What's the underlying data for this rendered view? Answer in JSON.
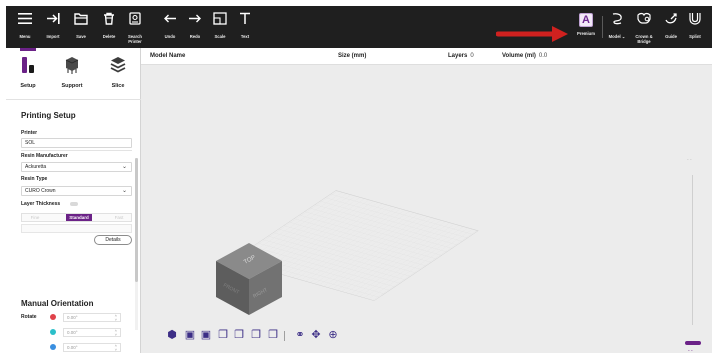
{
  "toolbar": {
    "items": [
      {
        "label": "Menu",
        "icon": "hamburger-icon"
      },
      {
        "label": "Import",
        "icon": "import-icon"
      },
      {
        "label": "Save",
        "icon": "save-icon"
      },
      {
        "label": "Delete",
        "icon": "trash-icon"
      },
      {
        "label": "Search\nPrinter",
        "icon": "search-printer-icon"
      },
      {
        "label": "Undo",
        "icon": "undo-icon"
      },
      {
        "label": "Redo",
        "icon": "redo-icon"
      },
      {
        "label": "Scale",
        "icon": "scale-icon"
      },
      {
        "label": "Text",
        "icon": "text-icon"
      }
    ],
    "right_items": [
      {
        "label": "Premium",
        "icon": "premium-icon",
        "glyph": "A"
      },
      {
        "label": "Model",
        "icon": "model-icon",
        "has_dropdown": true
      },
      {
        "label": "Crown &\nBridge",
        "icon": "crown-bridge-icon",
        "has_dropdown": true
      },
      {
        "label": "Guide",
        "icon": "guide-icon"
      },
      {
        "label": "Splint",
        "icon": "splint-icon"
      }
    ],
    "annotation_arrow_color": "#d0211f"
  },
  "modes": [
    {
      "label": "Setup",
      "icon": "setup-icon"
    },
    {
      "label": "Support",
      "icon": "support-icon"
    },
    {
      "label": "Slice",
      "icon": "slice-icon"
    }
  ],
  "printing_setup": {
    "title": "Printing Setup",
    "printer_label": "Printer",
    "printer_value": "SOL",
    "resin_manufacturer_label": "Resin Manufacturer",
    "resin_manufacturer_value": "Ackuretta",
    "resin_type_label": "Resin Type",
    "resin_type_value": "CURO Crown",
    "layer_thickness_label": "Layer Thickness",
    "thickness_options": [
      "Fine",
      "Standard",
      "Fast"
    ],
    "thickness_selected": "Standard",
    "details_button": "Details"
  },
  "manual_orientation": {
    "title": "Manual Orientation",
    "rotate_label": "Rotate",
    "axes": [
      {
        "color": "#e0424a",
        "value": "0.00°"
      },
      {
        "color": "#2bbfc9",
        "value": "0.00°"
      },
      {
        "color": "#3a8fe0",
        "value": "0.00°"
      }
    ]
  },
  "model_table": {
    "columns": {
      "name": "Model Name",
      "size": "Size (mm)",
      "layers_label": "Layers",
      "layers_value": "0",
      "volume_label": "Volume (ml)",
      "volume_value": "0.0"
    }
  },
  "view_cube": {
    "top": "TOP",
    "right": "RIGHT",
    "front": "FRONT"
  },
  "accent_color": "#6b2287"
}
